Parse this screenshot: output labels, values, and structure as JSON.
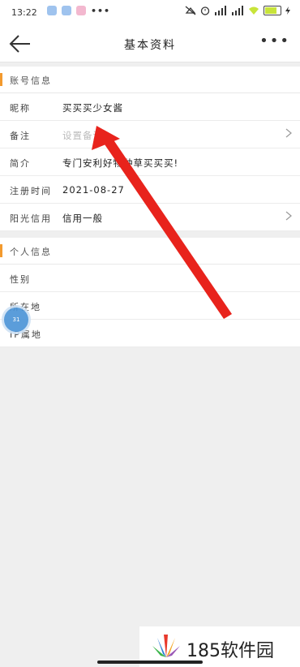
{
  "status_bar": {
    "time": "13:22",
    "more": "•••"
  },
  "nav": {
    "title": "基本资料",
    "more": "•••"
  },
  "account_section": {
    "title": "账号信息",
    "rows": [
      {
        "label": "昵称",
        "value": "买买买少女酱"
      },
      {
        "label": "备注",
        "placeholder": "设置备注"
      },
      {
        "label": "简介",
        "value": "专门安利好物种草买买买!"
      },
      {
        "label": "注册时间",
        "value": "2021-08-27"
      },
      {
        "label": "阳光信用",
        "value": "信用一般"
      }
    ]
  },
  "personal_section": {
    "title": "个人信息",
    "rows": [
      {
        "label": "性别",
        "value": ""
      },
      {
        "label": "所在地",
        "value": ""
      },
      {
        "label": "IP属地",
        "value": ""
      }
    ]
  },
  "floating_avatar": {
    "text": "31"
  },
  "annotation": {
    "arrow_color": "#e8231c"
  },
  "watermark": {
    "brand": "185软件园"
  }
}
